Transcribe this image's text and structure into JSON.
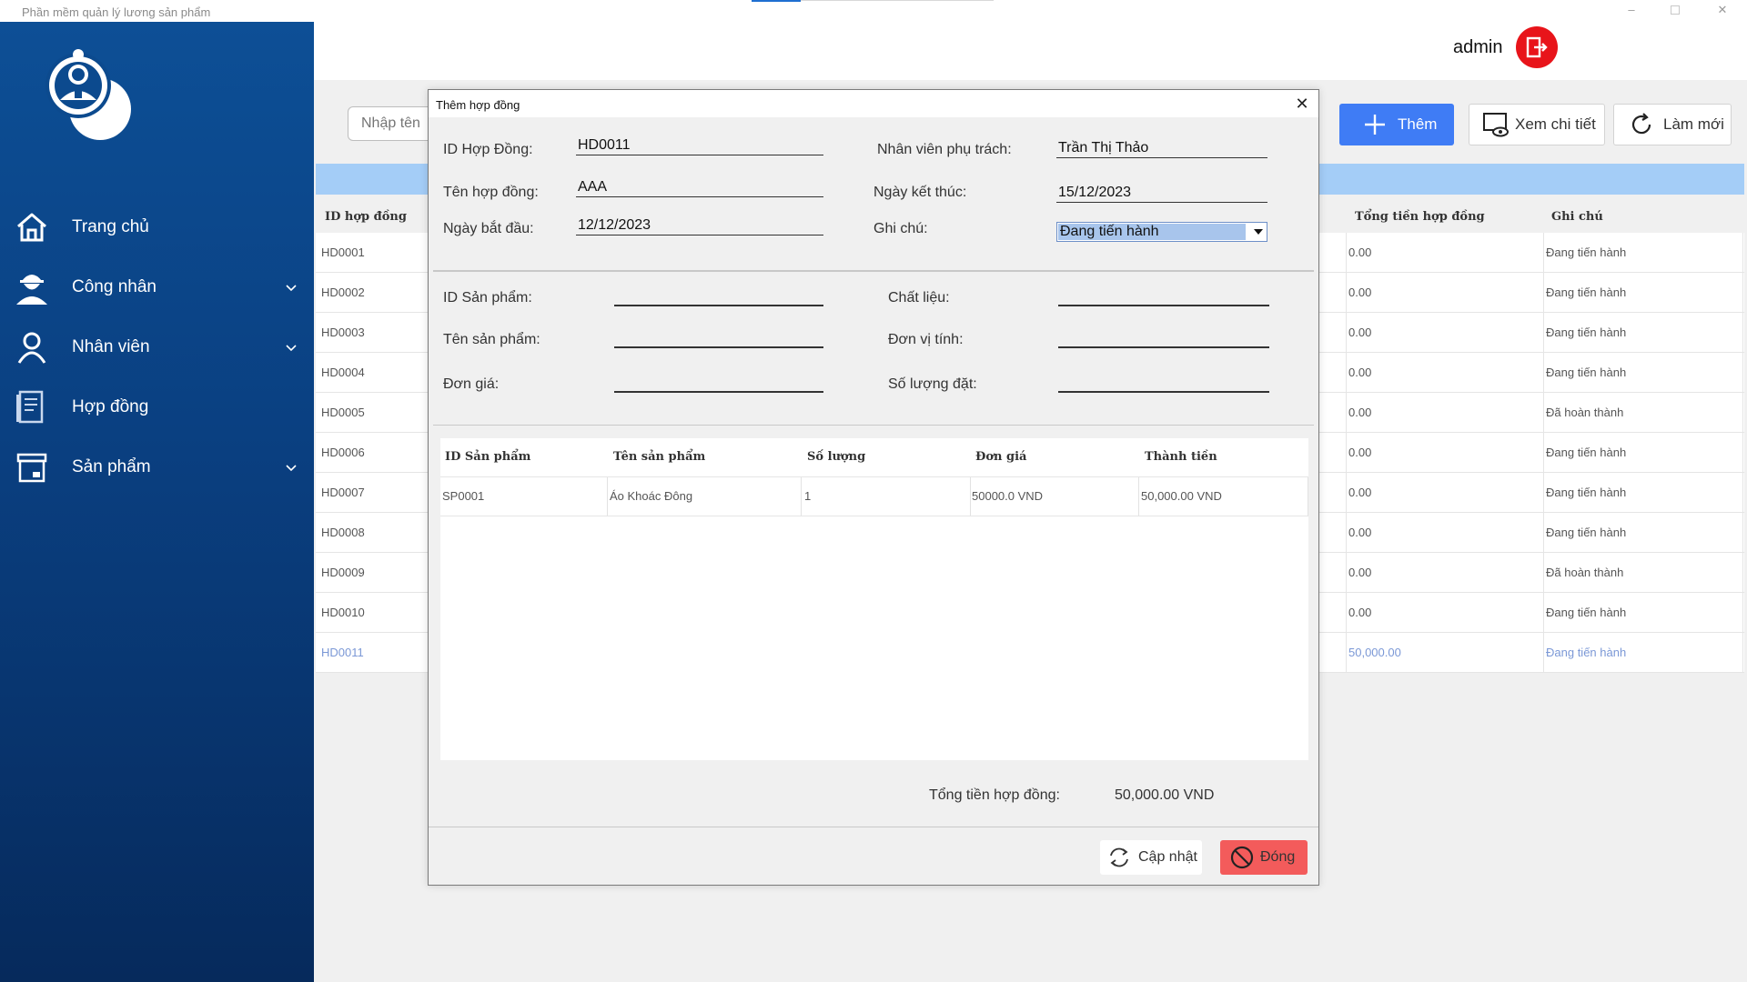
{
  "app": {
    "window_title": "Phần mềm quản lý lương sản phẩm",
    "user": "admin"
  },
  "sidebar": {
    "items": [
      {
        "label": "Trang chủ",
        "icon": "home-icon",
        "has_submenu": false
      },
      {
        "label": "Công nhân",
        "icon": "worker-icon",
        "has_submenu": true
      },
      {
        "label": "Nhân viên",
        "icon": "person-icon",
        "has_submenu": true
      },
      {
        "label": "Hợp đồng",
        "icon": "contract-icon",
        "has_submenu": false
      },
      {
        "label": "Sản phẩm",
        "icon": "product-box-icon",
        "has_submenu": true
      }
    ]
  },
  "toolbar": {
    "search_placeholder": "Nhập tên",
    "add_label": "Thêm",
    "view_label": "Xem chi tiết",
    "refresh_label": "Làm mới"
  },
  "contract_table": {
    "headers": {
      "id": "ID hợp đồng",
      "total": "Tổng tiền hợp đồng",
      "note": "Ghi chú"
    },
    "rows": [
      {
        "id": "HD0001",
        "total": "0.00",
        "note": "Đang tiến hành"
      },
      {
        "id": "HD0002",
        "total": "0.00",
        "note": "Đang tiến hành"
      },
      {
        "id": "HD0003",
        "total": "0.00",
        "note": "Đang tiến hành"
      },
      {
        "id": "HD0004",
        "total": "0.00",
        "note": "Đang tiến hành"
      },
      {
        "id": "HD0005",
        "total": "0.00",
        "note": "Đã hoàn thành"
      },
      {
        "id": "HD0006",
        "total": "0.00",
        "note": "Đang tiến hành"
      },
      {
        "id": "HD0007",
        "total": "0.00",
        "note": "Đang tiến hành"
      },
      {
        "id": "HD0008",
        "total": "0.00",
        "note": "Đang tiến hành"
      },
      {
        "id": "HD0009",
        "total": "0.00",
        "note": "Đã hoàn thành"
      },
      {
        "id": "HD0010",
        "total": "0.00",
        "note": "Đang tiến hành"
      },
      {
        "id": "HD0011",
        "total": "50,000.00",
        "note": "Đang tiến hành",
        "selected": true
      }
    ]
  },
  "dialog": {
    "title": "Thêm hợp đồng",
    "contract_id_label": "ID Hợp Đồng:",
    "contract_id": "HD0011",
    "contract_name_label": "Tên hợp đồng:",
    "contract_name": "AAA",
    "start_date_label": "Ngày bắt đầu:",
    "start_date": "12/12/2023",
    "staff_label": "Nhân viên phụ trách:",
    "staff": "Trần Thị Thảo",
    "end_date_label": "Ngày kết thúc:",
    "end_date": "15/12/2023",
    "note_label": "Ghi chú:",
    "note_selected": "Đang tiến hành",
    "product_id_label": "ID Sản phẩm:",
    "product_name_label": "Tên sản phẩm:",
    "unit_price_label": "Đơn giá:",
    "material_label": "Chất liệu:",
    "unit_label": "Đơn vị tính:",
    "quantity_label": "Số lượng đặt:",
    "product_id": "",
    "product_name": "",
    "unit_price": "",
    "material": "",
    "unit": "",
    "quantity": "",
    "grid": {
      "headers": [
        "ID Sản phẩm",
        "Tên sản phẩm",
        "Số lượng",
        "Đơn giá",
        "Thành tiền"
      ],
      "rows": [
        [
          "SP0001",
          "Áo Khoác Đông",
          "1",
          "50000.0 VND",
          "50,000.00 VND"
        ]
      ]
    },
    "total_label": "Tổng tiền hợp đồng:",
    "total_value": "50,000.00 VND",
    "update_label": "Cập nhật",
    "close_label": "Đóng"
  },
  "colors": {
    "sidebar_top": "#0d4f96",
    "sidebar_bottom": "#062a5c",
    "accent_blue": "#3f7cf5",
    "logout_red": "#e8141a",
    "close_button_red": "#f35b5b",
    "table_strip": "#a4cdf7"
  }
}
